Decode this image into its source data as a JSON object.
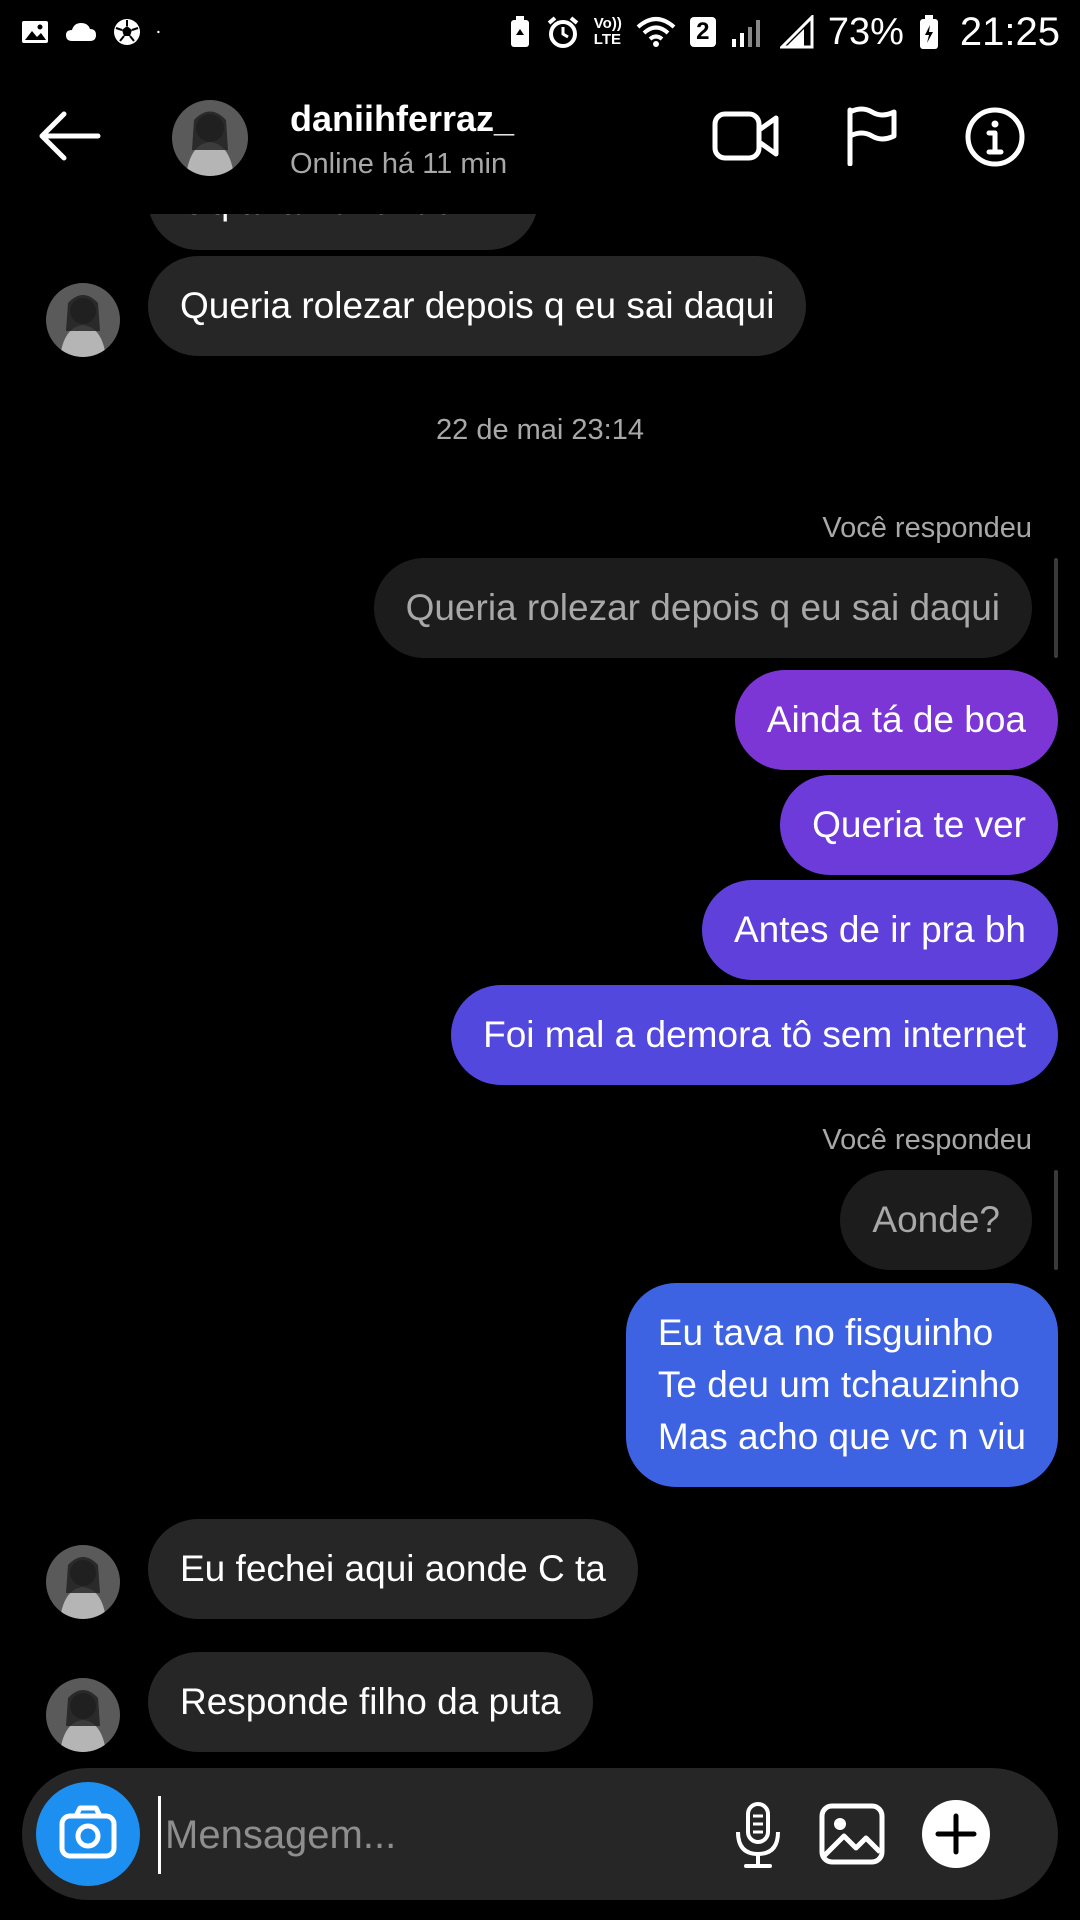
{
  "status_bar": {
    "battery": "73%",
    "time": "21:25",
    "volte_line1": "Vo))",
    "volte_line2": "LTE",
    "sim_slot": "2"
  },
  "header": {
    "username": "daniihferraz_",
    "status": "Online há 11 min"
  },
  "messages": {
    "partial_top": "Oq tá ta fazendo?",
    "in_1": "Queria rolezar depois q eu sai daqui",
    "timestamp": "22 de mai 23:14",
    "reply_label_1": "Você respondeu",
    "quote_1": "Queria rolezar depois q eu sai daqui",
    "out_1": "Ainda tá de boa",
    "out_2": "Queria te ver",
    "out_3": "Antes de ir pra bh",
    "out_4": "Foi mal a demora tô sem internet",
    "reply_label_2": "Você respondeu",
    "quote_2": "Aonde?",
    "out_5_line1": "Eu tava no fisguinho",
    "out_5_line2": "Te deu um tchauzinho",
    "out_5_line3": "Mas acho que vc n viu",
    "in_2": "Eu fechei aqui aonde C ta",
    "in_3": "Responde filho da puta"
  },
  "composer": {
    "placeholder": "Mensagem..."
  },
  "colors": {
    "background": "#000000",
    "incoming_bubble": "#262626",
    "outgoing_gradient_top": "#8a34d6",
    "outgoing_gradient_bottom": "#3a6ee6",
    "camera_button": "#1d8ff0"
  },
  "icons": {
    "back": "arrow-left-icon",
    "video": "video-camera-icon",
    "flag": "flag-icon",
    "info": "info-icon",
    "camera": "camera-icon",
    "mic": "microphone-icon",
    "gallery": "image-icon",
    "plus": "plus-icon"
  }
}
